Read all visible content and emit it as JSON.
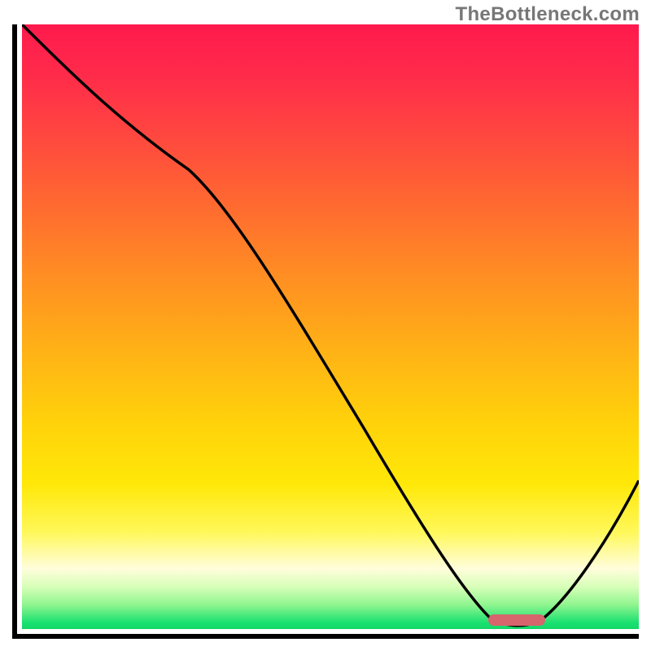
{
  "watermark": "TheBottleneck.com",
  "chart_data": {
    "type": "line",
    "title": "",
    "xlabel": "",
    "ylabel": "",
    "xlim": [
      0,
      100
    ],
    "ylim": [
      0,
      100
    ],
    "grid": false,
    "legend": false,
    "gradient_stops": [
      {
        "pos": 0,
        "color": "#ff1a4d"
      },
      {
        "pos": 30,
        "color": "#ff6a30"
      },
      {
        "pos": 66,
        "color": "#ffd20a"
      },
      {
        "pos": 90,
        "color": "#fffddc"
      },
      {
        "pos": 100,
        "color": "#14d868"
      }
    ],
    "series": [
      {
        "name": "curve",
        "color": "#000000",
        "x": [
          0,
          10,
          20,
          27,
          35,
          45,
          55,
          65,
          73,
          77,
          82,
          88,
          94,
          100
        ],
        "y": [
          100,
          92,
          83,
          76,
          63,
          48,
          33,
          18,
          6,
          1,
          0,
          5,
          14,
          24
        ]
      }
    ],
    "optimal_marker": {
      "x_start": 76,
      "x_end": 85,
      "y": 1
    }
  }
}
